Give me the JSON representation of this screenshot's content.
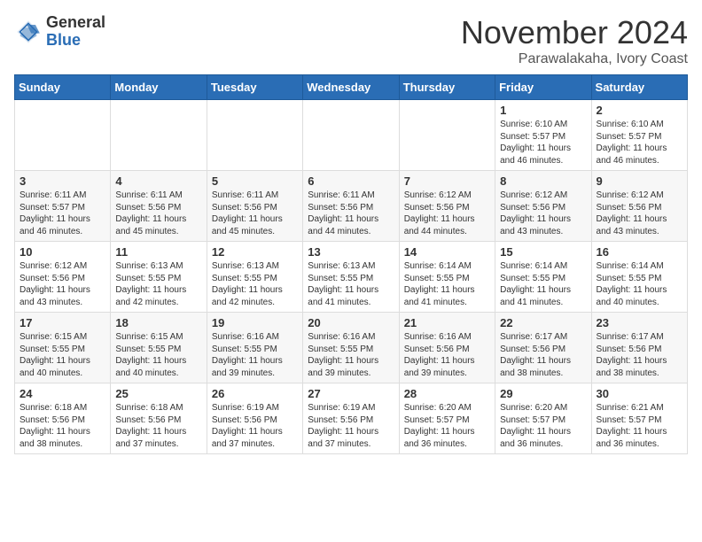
{
  "header": {
    "logo_general": "General",
    "logo_blue": "Blue",
    "month_year": "November 2024",
    "location": "Parawalakaha, Ivory Coast"
  },
  "calendar": {
    "days_of_week": [
      "Sunday",
      "Monday",
      "Tuesday",
      "Wednesday",
      "Thursday",
      "Friday",
      "Saturday"
    ],
    "weeks": [
      [
        {
          "day": "",
          "info": ""
        },
        {
          "day": "",
          "info": ""
        },
        {
          "day": "",
          "info": ""
        },
        {
          "day": "",
          "info": ""
        },
        {
          "day": "",
          "info": ""
        },
        {
          "day": "1",
          "info": "Sunrise: 6:10 AM\nSunset: 5:57 PM\nDaylight: 11 hours and 46 minutes."
        },
        {
          "day": "2",
          "info": "Sunrise: 6:10 AM\nSunset: 5:57 PM\nDaylight: 11 hours and 46 minutes."
        }
      ],
      [
        {
          "day": "3",
          "info": "Sunrise: 6:11 AM\nSunset: 5:57 PM\nDaylight: 11 hours and 46 minutes."
        },
        {
          "day": "4",
          "info": "Sunrise: 6:11 AM\nSunset: 5:56 PM\nDaylight: 11 hours and 45 minutes."
        },
        {
          "day": "5",
          "info": "Sunrise: 6:11 AM\nSunset: 5:56 PM\nDaylight: 11 hours and 45 minutes."
        },
        {
          "day": "6",
          "info": "Sunrise: 6:11 AM\nSunset: 5:56 PM\nDaylight: 11 hours and 44 minutes."
        },
        {
          "day": "7",
          "info": "Sunrise: 6:12 AM\nSunset: 5:56 PM\nDaylight: 11 hours and 44 minutes."
        },
        {
          "day": "8",
          "info": "Sunrise: 6:12 AM\nSunset: 5:56 PM\nDaylight: 11 hours and 43 minutes."
        },
        {
          "day": "9",
          "info": "Sunrise: 6:12 AM\nSunset: 5:56 PM\nDaylight: 11 hours and 43 minutes."
        }
      ],
      [
        {
          "day": "10",
          "info": "Sunrise: 6:12 AM\nSunset: 5:56 PM\nDaylight: 11 hours and 43 minutes."
        },
        {
          "day": "11",
          "info": "Sunrise: 6:13 AM\nSunset: 5:55 PM\nDaylight: 11 hours and 42 minutes."
        },
        {
          "day": "12",
          "info": "Sunrise: 6:13 AM\nSunset: 5:55 PM\nDaylight: 11 hours and 42 minutes."
        },
        {
          "day": "13",
          "info": "Sunrise: 6:13 AM\nSunset: 5:55 PM\nDaylight: 11 hours and 41 minutes."
        },
        {
          "day": "14",
          "info": "Sunrise: 6:14 AM\nSunset: 5:55 PM\nDaylight: 11 hours and 41 minutes."
        },
        {
          "day": "15",
          "info": "Sunrise: 6:14 AM\nSunset: 5:55 PM\nDaylight: 11 hours and 41 minutes."
        },
        {
          "day": "16",
          "info": "Sunrise: 6:14 AM\nSunset: 5:55 PM\nDaylight: 11 hours and 40 minutes."
        }
      ],
      [
        {
          "day": "17",
          "info": "Sunrise: 6:15 AM\nSunset: 5:55 PM\nDaylight: 11 hours and 40 minutes."
        },
        {
          "day": "18",
          "info": "Sunrise: 6:15 AM\nSunset: 5:55 PM\nDaylight: 11 hours and 40 minutes."
        },
        {
          "day": "19",
          "info": "Sunrise: 6:16 AM\nSunset: 5:55 PM\nDaylight: 11 hours and 39 minutes."
        },
        {
          "day": "20",
          "info": "Sunrise: 6:16 AM\nSunset: 5:55 PM\nDaylight: 11 hours and 39 minutes."
        },
        {
          "day": "21",
          "info": "Sunrise: 6:16 AM\nSunset: 5:56 PM\nDaylight: 11 hours and 39 minutes."
        },
        {
          "day": "22",
          "info": "Sunrise: 6:17 AM\nSunset: 5:56 PM\nDaylight: 11 hours and 38 minutes."
        },
        {
          "day": "23",
          "info": "Sunrise: 6:17 AM\nSunset: 5:56 PM\nDaylight: 11 hours and 38 minutes."
        }
      ],
      [
        {
          "day": "24",
          "info": "Sunrise: 6:18 AM\nSunset: 5:56 PM\nDaylight: 11 hours and 38 minutes."
        },
        {
          "day": "25",
          "info": "Sunrise: 6:18 AM\nSunset: 5:56 PM\nDaylight: 11 hours and 37 minutes."
        },
        {
          "day": "26",
          "info": "Sunrise: 6:19 AM\nSunset: 5:56 PM\nDaylight: 11 hours and 37 minutes."
        },
        {
          "day": "27",
          "info": "Sunrise: 6:19 AM\nSunset: 5:56 PM\nDaylight: 11 hours and 37 minutes."
        },
        {
          "day": "28",
          "info": "Sunrise: 6:20 AM\nSunset: 5:57 PM\nDaylight: 11 hours and 36 minutes."
        },
        {
          "day": "29",
          "info": "Sunrise: 6:20 AM\nSunset: 5:57 PM\nDaylight: 11 hours and 36 minutes."
        },
        {
          "day": "30",
          "info": "Sunrise: 6:21 AM\nSunset: 5:57 PM\nDaylight: 11 hours and 36 minutes."
        }
      ]
    ]
  }
}
